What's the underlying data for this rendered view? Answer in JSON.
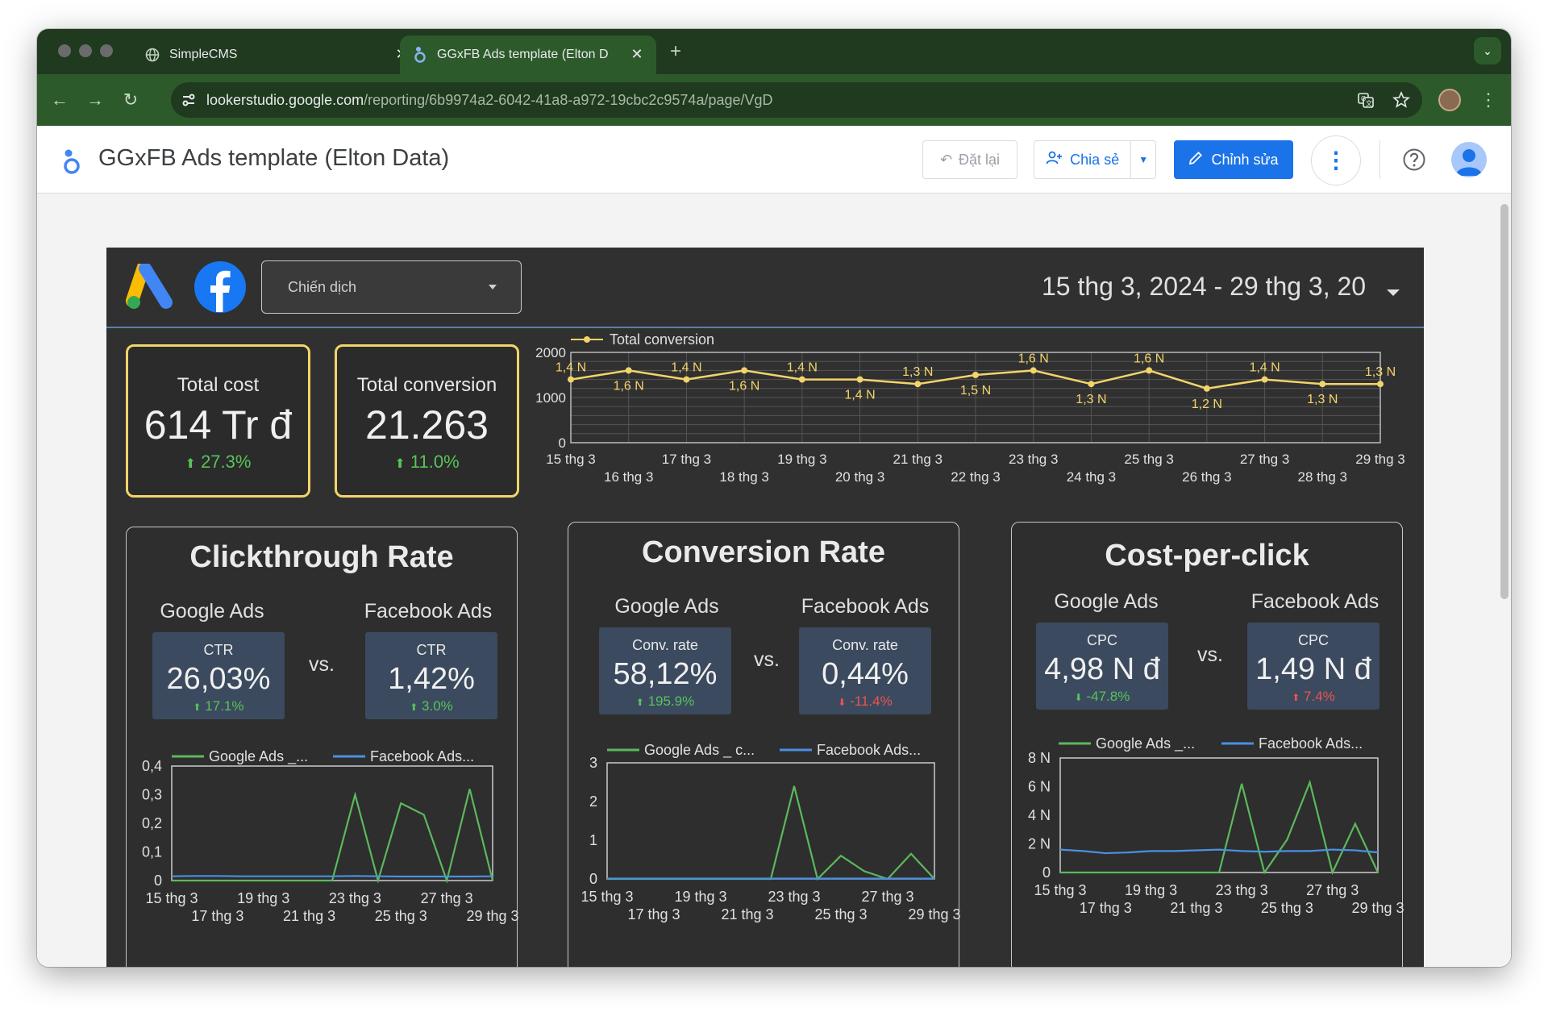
{
  "browser": {
    "tabs": [
      {
        "title": "SimpleCMS"
      },
      {
        "title": "GGxFB Ads template (Elton D"
      }
    ],
    "url_host": "lookerstudio.google.com",
    "url_path": "/reporting/6b9974a2-6042-41a8-a972-19cbc2c9574a/page/VgD"
  },
  "app": {
    "title": "GGxFB Ads template (Elton Data)",
    "reset_label": "Đặt lại",
    "share_label": "Chia sẻ",
    "edit_label": "Chỉnh sửa"
  },
  "report": {
    "campaign_placeholder": "Chiến dịch",
    "date_range": "15 thg 3, 2024 - 29 thg 3, 20",
    "kpis": [
      {
        "label": "Total cost",
        "value": "614 Tr đ",
        "delta": "27.3%"
      },
      {
        "label": "Total conversion",
        "value": "21.263",
        "delta": "11.0%"
      }
    ],
    "panels": [
      {
        "title": "Clickthrough Rate",
        "left_label": "Google Ads",
        "right_label": "Facebook Ads",
        "vs": "vs.",
        "left": {
          "metric": "CTR",
          "value": "26,03%",
          "delta": "17.1%",
          "dir": "up"
        },
        "right": {
          "metric": "CTR",
          "value": "1,42%",
          "delta": "3.0%",
          "dir": "up"
        }
      },
      {
        "title": "Conversion Rate",
        "left_label": "Google Ads",
        "right_label": "Facebook Ads",
        "vs": "vs.",
        "left": {
          "metric": "Conv. rate",
          "value": "58,12%",
          "delta": "195.9%",
          "dir": "up"
        },
        "right": {
          "metric": "Conv. rate",
          "value": "0,44%",
          "delta": "-11.4%",
          "dir": "down"
        }
      },
      {
        "title": "Cost-per-click",
        "left_label": "Google Ads",
        "right_label": "Facebook Ads",
        "vs": "vs.",
        "left": {
          "metric": "CPC",
          "value": "4,98 N đ",
          "delta": "-47.8%",
          "dir": "down_good"
        },
        "right": {
          "metric": "CPC",
          "value": "1,49 N đ",
          "delta": "7.4%",
          "dir": "up_bad"
        }
      }
    ]
  },
  "colors": {
    "accent_yellow": "#f3d46a",
    "google_series": "#5cb85c",
    "facebook_series": "#4a90e2",
    "positive": "#57c45a",
    "negative": "#ef5350",
    "edit_button": "#1a73e8"
  },
  "chart_data": [
    {
      "type": "line",
      "legend": [
        "Total conversion"
      ],
      "x": [
        "15 thg 3",
        "16 thg 3",
        "17 thg 3",
        "18 thg 3",
        "19 thg 3",
        "20 thg 3",
        "21 thg 3",
        "22 thg 3",
        "23 thg 3",
        "24 thg 3",
        "25 thg 3",
        "26 thg 3",
        "27 thg 3",
        "28 thg 3",
        "29 thg 3"
      ],
      "series": [
        {
          "name": "Total conversion",
          "values": [
            1400,
            1600,
            1400,
            1600,
            1400,
            1400,
            1300,
            1500,
            1600,
            1300,
            1600,
            1200,
            1400,
            1300,
            1300
          ]
        }
      ],
      "data_labels": [
        "1,4 N",
        "1,6 N",
        "1,4 N",
        "1,6 N",
        "1,4 N",
        "1,4 N",
        "1,3 N",
        "1,5 N",
        "1,6 N",
        "1,3 N",
        "1,6 N",
        "1,2 N",
        "1,4 N",
        "1,3 N",
        "1,3 N"
      ],
      "y_ticks": [
        "0",
        "1000",
        "2000"
      ],
      "ylim": [
        0,
        2000
      ],
      "grid": true
    },
    {
      "type": "line",
      "legend": [
        "Google Ads _...",
        "Facebook Ads..."
      ],
      "x": [
        "15 thg 3",
        "16 thg 3",
        "17 thg 3",
        "18 thg 3",
        "19 thg 3",
        "20 thg 3",
        "21 thg 3",
        "22 thg 3",
        "23 thg 3",
        "24 thg 3",
        "25 thg 3",
        "26 thg 3",
        "27 thg 3",
        "28 thg 3",
        "29 thg 3"
      ],
      "x_tick_labels": [
        "15 thg 3",
        "17 thg 3",
        "19 thg 3",
        "21 thg 3",
        "23 thg 3",
        "25 thg 3",
        "27 thg 3",
        "29 thg 3"
      ],
      "series": [
        {
          "name": "Google Ads _...",
          "values": [
            0,
            0,
            0,
            0,
            0,
            0,
            0,
            0,
            0.3,
            0,
            0.27,
            0.23,
            0,
            0.32,
            0
          ]
        },
        {
          "name": "Facebook Ads...",
          "values": [
            0.015,
            0.016,
            0.016,
            0.015,
            0.015,
            0.015,
            0.015,
            0.015,
            0.016,
            0.015,
            0.014,
            0.014,
            0.014,
            0.014,
            0.015
          ]
        }
      ],
      "y_ticks": [
        "0",
        "0,1",
        "0,2",
        "0,3",
        "0,4"
      ],
      "ylim": [
        0,
        0.4
      ]
    },
    {
      "type": "line",
      "legend": [
        "Google Ads _ c...",
        "Facebook Ads..."
      ],
      "x": [
        "15 thg 3",
        "16 thg 3",
        "17 thg 3",
        "18 thg 3",
        "19 thg 3",
        "20 thg 3",
        "21 thg 3",
        "22 thg 3",
        "23 thg 3",
        "24 thg 3",
        "25 thg 3",
        "26 thg 3",
        "27 thg 3",
        "28 thg 3",
        "29 thg 3"
      ],
      "x_tick_labels": [
        "15 thg 3",
        "17 thg 3",
        "19 thg 3",
        "21 thg 3",
        "23 thg 3",
        "25 thg 3",
        "27 thg 3",
        "29 thg 3"
      ],
      "series": [
        {
          "name": "Google Ads _ c...",
          "values": [
            0,
            0,
            0,
            0,
            0,
            0,
            0,
            0,
            2.4,
            0,
            0.6,
            0.2,
            0,
            0.65,
            0
          ]
        },
        {
          "name": "Facebook Ads...",
          "values": [
            0.01,
            0.01,
            0.01,
            0.01,
            0.01,
            0.01,
            0.01,
            0.01,
            0.01,
            0.01,
            0.01,
            0.01,
            0.01,
            0.01,
            0.01
          ]
        }
      ],
      "y_ticks": [
        "0",
        "1",
        "2",
        "3"
      ],
      "ylim": [
        0,
        3
      ]
    },
    {
      "type": "line",
      "legend": [
        "Google Ads _...",
        "Facebook Ads..."
      ],
      "x": [
        "15 thg 3",
        "16 thg 3",
        "17 thg 3",
        "18 thg 3",
        "19 thg 3",
        "20 thg 3",
        "21 thg 3",
        "22 thg 3",
        "23 thg 3",
        "24 thg 3",
        "25 thg 3",
        "26 thg 3",
        "27 thg 3",
        "28 thg 3",
        "29 thg 3"
      ],
      "x_tick_labels": [
        "15 thg 3",
        "17 thg 3",
        "19 thg 3",
        "21 thg 3",
        "23 thg 3",
        "25 thg 3",
        "27 thg 3",
        "29 thg 3"
      ],
      "series": [
        {
          "name": "Google Ads _...",
          "values": [
            0,
            0,
            0,
            0,
            0,
            0,
            0,
            0,
            6200,
            0,
            2300,
            6300,
            0,
            3400,
            0
          ]
        },
        {
          "name": "Facebook Ads...",
          "values": [
            1600,
            1500,
            1350,
            1400,
            1500,
            1500,
            1550,
            1600,
            1500,
            1450,
            1500,
            1500,
            1600,
            1550,
            1400
          ]
        }
      ],
      "y_ticks": [
        "0",
        "2 N",
        "4 N",
        "6 N",
        "8 N"
      ],
      "ylim": [
        0,
        8000
      ]
    }
  ]
}
